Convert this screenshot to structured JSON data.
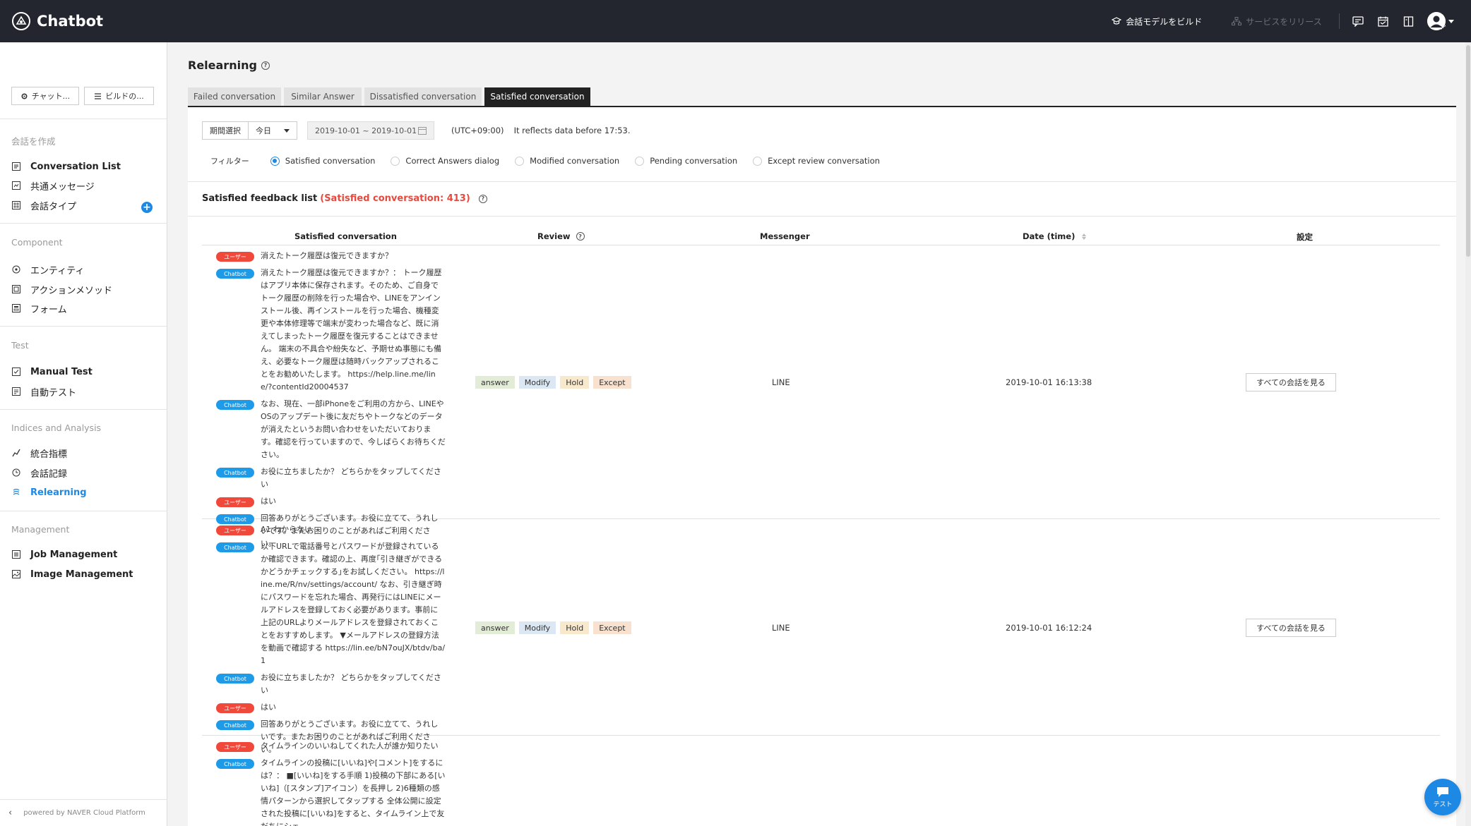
{
  "app": {
    "name": "Chatbot"
  },
  "topbar": {
    "build_label": "会話モデルをビルド",
    "release_label": "サービスをリリース",
    "locale": "JP"
  },
  "sidebar": {
    "buttons": [
      "チャット...",
      "ビルドの..."
    ],
    "sections": [
      {
        "title": "会話を作成",
        "items": [
          "Conversation List",
          "共通メッセージ",
          "会話タイプ"
        ]
      },
      {
        "title": "Component",
        "items": [
          "エンティティ",
          "アクションメソッド",
          "フォーム"
        ]
      },
      {
        "title": "Test",
        "items": [
          "Manual Test",
          "自動テスト"
        ]
      },
      {
        "title": "Indices and Analysis",
        "items": [
          "統合指標",
          "会話記録",
          "Relearning"
        ]
      },
      {
        "title": "Management",
        "items": [
          "Job Management",
          "Image Management"
        ]
      }
    ],
    "footer": "powered by NAVER Cloud Platform"
  },
  "page": {
    "title": "Relearning",
    "tabs": [
      "Failed conversation",
      "Similar Answer",
      "Dissatisfied conversation",
      "Satisfied conversation"
    ],
    "active_tab": 3
  },
  "filters": {
    "period_label": "期間選択",
    "period_value": "今日",
    "date_range": "2019-10-01 ~ 2019-10-01",
    "timezone": "(UTC+09:00)",
    "reflect_note": "It reflects data before 17:53.",
    "filter_label": "フィルター",
    "options": [
      "Satisfied conversation",
      "Correct Answers dialog",
      "Modified conversation",
      "Pending conversation",
      "Except review conversation"
    ],
    "selected": 0
  },
  "list": {
    "title": "Satisfied feedback list",
    "count_text": "(Satisfied conversation: 413)",
    "columns": [
      "Satisfied conversation",
      "Review",
      "Messenger",
      "Date (time)",
      "設定"
    ]
  },
  "labels": {
    "user": "ユーザー",
    "bot": "Chatbot",
    "review_tags": [
      "answer",
      "Modify",
      "Hold",
      "Except"
    ],
    "view_all": "すべての会話を見る",
    "test": "テスト"
  },
  "rows": [
    {
      "messages": [
        {
          "who": "user",
          "text": "消えたトーク履歴は復元できますか？"
        },
        {
          "who": "bot",
          "text": "消えたトーク履歴は復元できますか？： トーク履歴はアプリ本体に保存されます。そのため、ご自身でトーク履歴の削除を行った場合や、LINEをアンインストール後、再インストールを行った場合、機種変更や本体修理等で端末が変わった場合など、既に消えてしまったトーク履歴を復元することはできません。 端末の不具合や紛失など、予期せぬ事態にも備え、必要なトーク履歴は随時バックアップされることをお勧めいたします。 https://help.line.me/line/?contentId20004537"
        },
        {
          "who": "bot",
          "text": "なお、現在、一部iPhoneをご利用の方から、LINEやOSのアップデート後に友だちやトークなどのデータが消えたというお問い合わせをいただいております。確認を行っていますので、今しばらくお待ちください。"
        },
        {
          "who": "bot",
          "text": "お役に立ちましたか？ どちらかをタップしてください"
        },
        {
          "who": "user",
          "text": "はい"
        },
        {
          "who": "bot",
          "text": "回答ありがとうございます。お役に立てて、うれしいです。またお困りのことがあればご利用ください。"
        }
      ],
      "messenger": "LINE",
      "date": "2019-10-01 16:13:38"
    },
    {
      "messages": [
        {
          "who": "user",
          "text": "A1 わからない"
        },
        {
          "who": "bot",
          "text": "以下URLで電話番号とパスワードが登録されているか確認できます。確認の上、再度｢引き継ぎができるかどうかチェックする｣をお試しください。 https://line.me/R/nv/settings/account/ なお、引き継ぎ時にパスワードを忘れた場合、再発行にはLINEにメールアドレスを登録しておく必要があります。事前に上記のURLよりメールアドレスを登録されておくことをおすすめします。 ▼メールアドレスの登録方法を動画で確認する https://lin.ee/bN7ouJX/btdv/ba/1"
        },
        {
          "who": "bot",
          "text": "お役に立ちましたか？ どちらかをタップしてください"
        },
        {
          "who": "user",
          "text": "はい"
        },
        {
          "who": "bot",
          "text": "回答ありがとうございます。お役に立てて、うれしいです。またお困りのことがあればご利用ください。"
        }
      ],
      "messenger": "LINE",
      "date": "2019-10-01 16:12:24"
    },
    {
      "messages": [
        {
          "who": "user",
          "text": "タイムラインのいいねしてくれた人が誰か知りたい"
        },
        {
          "who": "bot",
          "text": "タイムラインの投稿に[いいね]や[コメント]をするには？： ■[いいね]をする手順 1)投稿の下部にある[いいね]（[スタンプ]アイコン）を長押し 2)6種類の感情パターンから選択してタップする 全体公開に設定された投稿に[いいね]をすると、タイムライン上で友だちにシェ"
        }
      ],
      "messenger": "",
      "date": ""
    }
  ]
}
